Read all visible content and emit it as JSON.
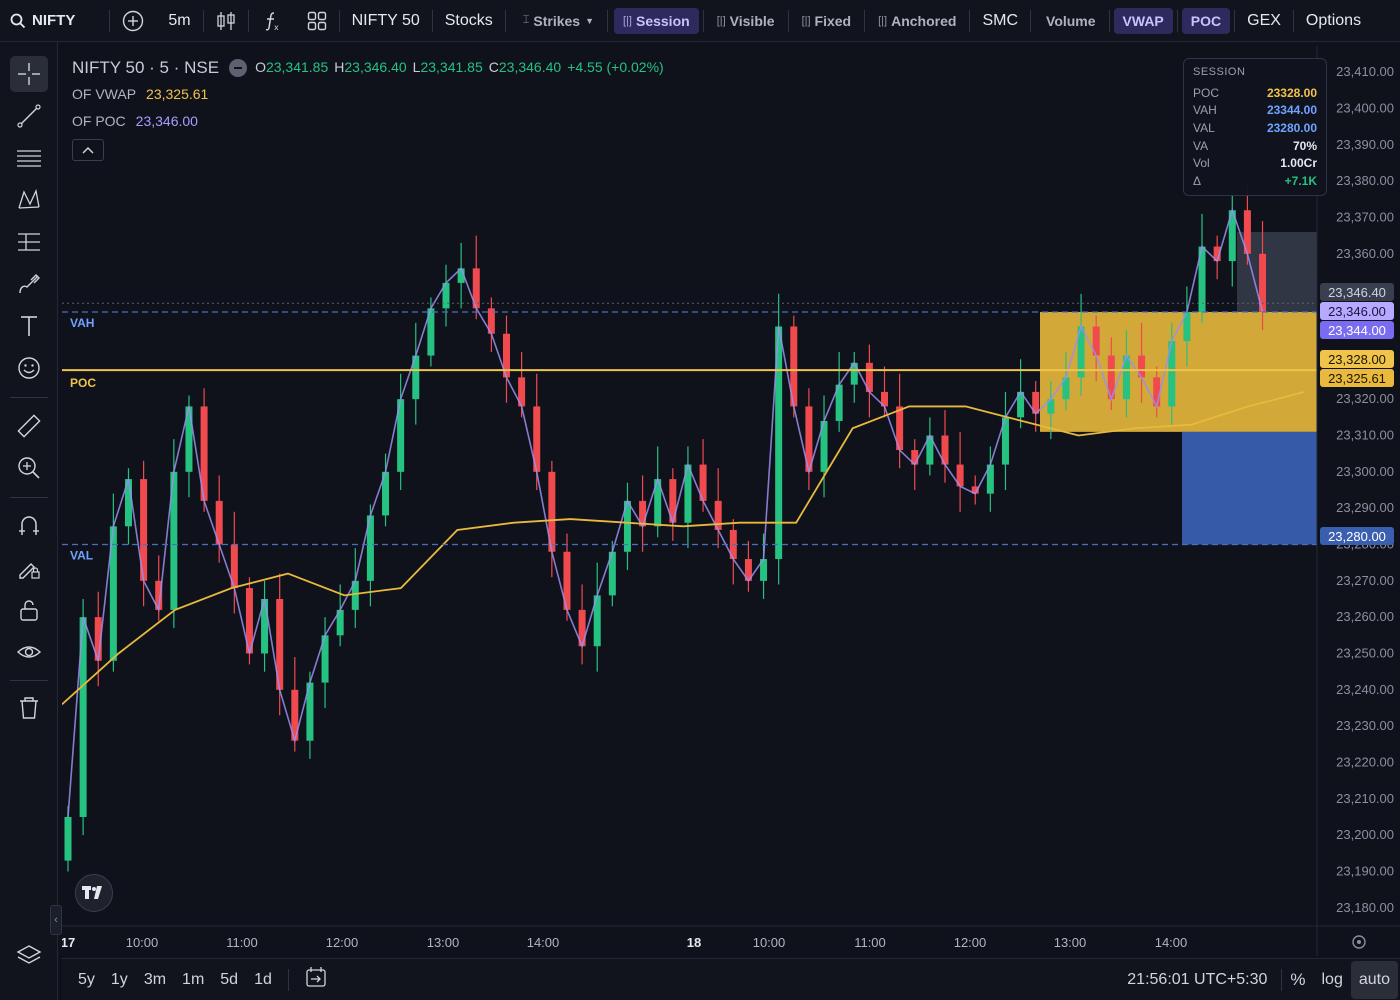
{
  "topbar": {
    "symbol": "NIFTY",
    "interval": "5m",
    "index": "NIFTY 50",
    "stocks": "Stocks",
    "strikes": "Strikes",
    "chips": [
      {
        "label": "Session",
        "active": true
      },
      {
        "label": "Visible",
        "active": false
      },
      {
        "label": "Fixed",
        "active": false
      },
      {
        "label": "Anchored",
        "active": false
      }
    ],
    "smc": "SMC",
    "volume": "Volume",
    "vwap": "VWAP",
    "poc": "POC",
    "gex": "GEX",
    "options": "Options"
  },
  "legend": {
    "title": "NIFTY 50 · 5 · NSE",
    "o_label": "O",
    "o": "23,341.85",
    "h_label": "H",
    "h": "23,346.40",
    "l_label": "L",
    "l": "23,341.85",
    "c_label": "C",
    "c": "23,346.40",
    "change": "+4.55 (+0.02%)",
    "vwap_label": "OF VWAP",
    "vwap_value": "23,325.61",
    "poc_label": "OF POC",
    "poc_value": "23,346.00"
  },
  "session_panel": {
    "header": "SESSION",
    "rows": [
      {
        "k": "POC",
        "v": "23328.00",
        "color": "#f0c34a"
      },
      {
        "k": "VAH",
        "v": "23344.00",
        "color": "#6fa3ff"
      },
      {
        "k": "VAL",
        "v": "23280.00",
        "color": "#6fa3ff"
      },
      {
        "k": "VA",
        "v": "70%",
        "color": "#e6e8ee"
      },
      {
        "k": "Vol",
        "v": "1.00Cr",
        "color": "#e6e8ee"
      },
      {
        "k": "Δ",
        "v": "+7.1K",
        "color": "#26c281"
      }
    ]
  },
  "chart_labels": {
    "vah": "VAH",
    "poc": "POC",
    "val": "VAL"
  },
  "price_axis": {
    "ticks": [
      "23,410.00",
      "23,400.00",
      "23,390.00",
      "23,380.00",
      "23,370.00",
      "23,360.00",
      "23,350.00",
      "23,320.00",
      "23,310.00",
      "23,300.00",
      "23,290.00",
      "23,280.00",
      "23,270.00",
      "23,260.00",
      "23,250.00",
      "23,240.00",
      "23,230.00",
      "23,220.00",
      "23,210.00",
      "23,200.00",
      "23,190.00",
      "23,180.00"
    ],
    "tags": [
      {
        "text": "23,346.40",
        "bg": "#3a3f50",
        "fg": "#d1d4dc"
      },
      {
        "text": "23,346.00",
        "bg": "#b7a9ff",
        "fg": "#1a1540"
      },
      {
        "text": "23,344.00",
        "bg": "#7a6cf0",
        "fg": "#ffffff"
      },
      {
        "text": "23,328.00",
        "bg": "#f0c34a",
        "fg": "#1a1400"
      },
      {
        "text": "23,325.61",
        "bg": "#e8b93c",
        "fg": "#1a1400"
      },
      {
        "text": "23,280.00",
        "bg": "#3b5fb0",
        "fg": "#ffffff"
      }
    ]
  },
  "time_axis": [
    "17",
    "10:00",
    "11:00",
    "12:00",
    "13:00",
    "14:00",
    "18",
    "10:00",
    "11:00",
    "12:00",
    "13:00",
    "14:00"
  ],
  "bottombar": {
    "ranges": [
      "5y",
      "1y",
      "3m",
      "1m",
      "5d",
      "1d"
    ],
    "clock": "21:56:01 UTC+5:30",
    "pct": "%",
    "log": "log",
    "auto": "auto"
  },
  "colors": {
    "up": "#26c281",
    "down": "#f04a4f",
    "vwap": "#e8b93c",
    "poc": "#f0c34a",
    "vah_line": "#4a6fc0",
    "close_line": "#9a8ff0",
    "bg": "#0f121b"
  },
  "chart_data": {
    "type": "candlestick",
    "ylim": [
      23175,
      23415
    ],
    "close_series": [
      23205,
      23260,
      23248,
      23285,
      23298,
      23270,
      23262,
      23300,
      23318,
      23292,
      23280,
      23268,
      23250,
      23265,
      23240,
      23226,
      23242,
      23255,
      23262,
      23270,
      23288,
      23300,
      23320,
      23332,
      23345,
      23352,
      23356,
      23345,
      23338,
      23326,
      23318,
      23300,
      23278,
      23262,
      23252,
      23266,
      23278,
      23292,
      23285,
      23298,
      23286,
      23302,
      23292,
      23284,
      23276,
      23270,
      23276,
      23340,
      23318,
      23300,
      23314,
      23324,
      23330,
      23322,
      23318,
      23306,
      23302,
      23310,
      23302,
      23296,
      23294,
      23302,
      23315,
      23322,
      23316,
      23320,
      23326,
      23340,
      23332,
      23320,
      23332,
      23326,
      23318,
      23336,
      23344,
      23362,
      23358,
      23372,
      23360,
      23344
    ],
    "vwap_series": [
      23236,
      23250,
      23262,
      23268,
      23272,
      23266,
      23268,
      23284,
      23286,
      23287,
      23286,
      23285,
      23286,
      23286,
      23312,
      23318,
      23318,
      23314,
      23310,
      23312,
      23313,
      23318,
      23322
    ],
    "profile": {
      "poc": 23328,
      "vah": 23344,
      "val": 23280
    }
  }
}
